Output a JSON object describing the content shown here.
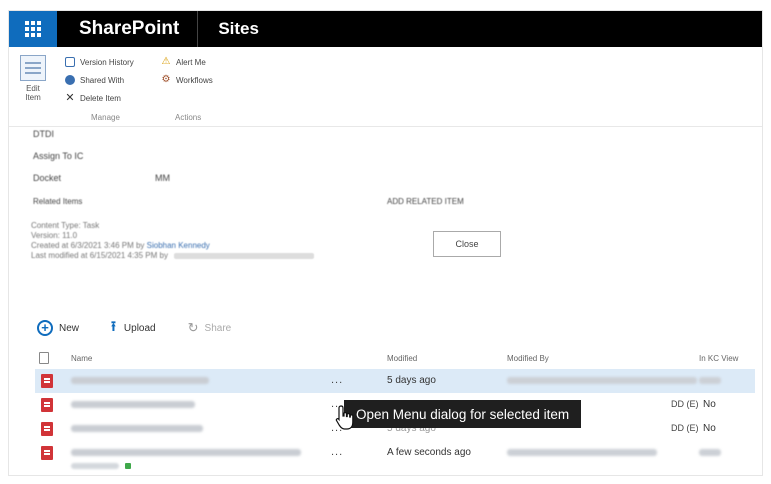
{
  "topbar": {
    "app_name": "SharePoint",
    "site_label": "Sites"
  },
  "ribbon": {
    "edit_item": "Edit Item",
    "manage": {
      "label": "Manage",
      "items": [
        "Version History",
        "Shared With",
        "Delete Item"
      ]
    },
    "actions": {
      "label": "Actions",
      "items": [
        "Alert Me",
        "Workflows"
      ]
    }
  },
  "item_form": {
    "field_top": "DTDI",
    "assign_to": "Assign To IC",
    "docket_label": "Docket",
    "docket_value": "MM",
    "related_items_label": "Related Items",
    "add_related": "ADD RELATED ITEM",
    "content_type": "Content Type: Task",
    "version": "Version: 11.0",
    "created": "Created at 6/3/2021 3:46 PM by",
    "created_by": "Siobhan Kennedy",
    "last_modified": "Last modified at 6/15/2021 4:35 PM by",
    "close_button": "Close"
  },
  "commandbar": {
    "new": "New",
    "upload": "Upload",
    "share": "Share"
  },
  "list": {
    "headers": {
      "name": "Name",
      "modified": "Modified",
      "modified_by": "Modified By",
      "inkc_view": "In KC View"
    },
    "rows": [
      {
        "modified": "5 days ago",
        "modby_end": "",
        "inkc": "",
        "selected": true
      },
      {
        "modified": "",
        "modby_end": "DD (E)",
        "inkc": "No",
        "selected": false
      },
      {
        "modified": "5 days ago",
        "modby_end": "DD (E)",
        "inkc": "No",
        "selected": false
      },
      {
        "modified": "A few seconds ago",
        "modby_end": "",
        "inkc": "",
        "selected": false
      }
    ]
  },
  "tooltip": {
    "text": "Open Menu dialog for selected item"
  },
  "icons": {
    "app_launcher": "waffle-icon",
    "new": "plus-circle-icon",
    "upload": "upload-arrow-icon",
    "share": "share-icon",
    "file": "pdf-file-icon",
    "cursor": "hand-pointer-icon"
  },
  "colors": {
    "suite_bar": "#000000",
    "launcher_blue": "#0f6cbd",
    "selected_row": "#dceaf7",
    "tooltip_bg": "#1f1f1f",
    "pdf_red": "#d13438"
  }
}
